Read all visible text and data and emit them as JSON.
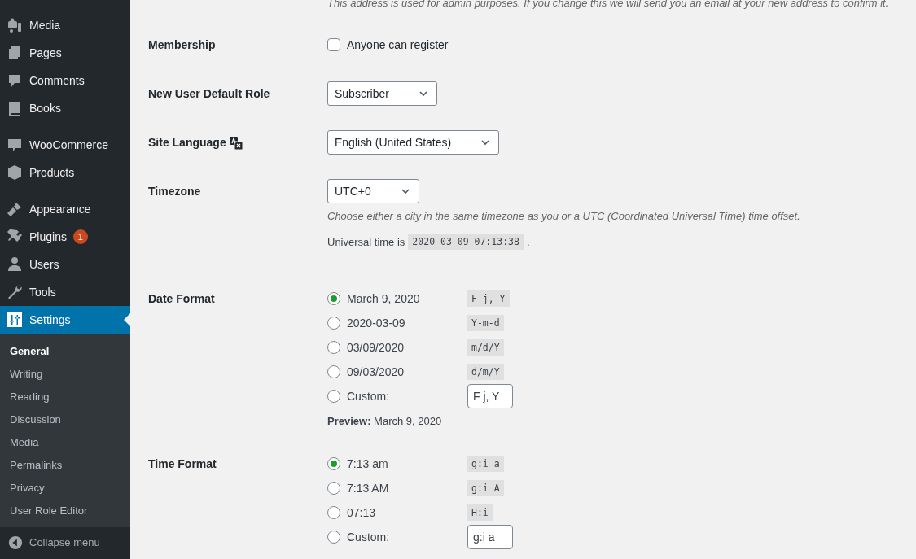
{
  "sidebar": {
    "groups": [
      [
        {
          "label": "Media",
          "selected": false
        },
        {
          "label": "Pages",
          "selected": false
        },
        {
          "label": "Comments",
          "selected": false
        },
        {
          "label": "Books",
          "selected": false
        }
      ],
      [
        {
          "label": "WooCommerce",
          "selected": false
        },
        {
          "label": "Products",
          "selected": false
        }
      ],
      [
        {
          "label": "Appearance",
          "selected": false
        },
        {
          "label": "Plugins",
          "selected": false,
          "badge": "1"
        },
        {
          "label": "Users",
          "selected": false
        },
        {
          "label": "Tools",
          "selected": false
        },
        {
          "label": "Settings",
          "selected": true
        }
      ]
    ],
    "submenu": [
      {
        "label": "General",
        "selected": true
      },
      {
        "label": "Writing",
        "selected": false
      },
      {
        "label": "Reading",
        "selected": false
      },
      {
        "label": "Discussion",
        "selected": false
      },
      {
        "label": "Media",
        "selected": false
      },
      {
        "label": "Permalinks",
        "selected": false
      },
      {
        "label": "Privacy",
        "selected": false
      },
      {
        "label": "User Role Editor",
        "selected": false
      }
    ],
    "collapse": "Collapse menu"
  },
  "top_description": "This address is used for admin purposes. If you change this we will send you an email at your new address to confirm it.",
  "settings": [
    {
      "kind": "checkbox",
      "label": "Membership",
      "option": {
        "label": "Anyone can register",
        "checked": false
      }
    },
    {
      "kind": "select",
      "label": "New User Default Role",
      "value": "Subscriber"
    },
    {
      "kind": "select",
      "label": "Site Language",
      "language_icon": true,
      "value": "English (United States)"
    },
    {
      "kind": "select",
      "label": "Timezone",
      "value": "UTC+0",
      "description": "Choose either a city in the same timezone as you or a UTC (Coordinated Universal Time) time offset.",
      "universal_time": {
        "prefix": "Universal time is",
        "value": "2020-03-09 07:13:38",
        "suffix": "."
      }
    },
    {
      "kind": "radios",
      "label": "Date Format",
      "options": [
        {
          "label": "March 9, 2020",
          "code": "F j, Y",
          "selected": true
        },
        {
          "label": "2020-03-09",
          "code": "Y-m-d",
          "selected": false
        },
        {
          "label": "03/09/2020",
          "code": "m/d/Y",
          "selected": false
        },
        {
          "label": "09/03/2020",
          "code": "d/m/Y",
          "selected": false
        }
      ],
      "custom": {
        "label": "Custom:",
        "value": "F j, Y",
        "selected": false
      },
      "preview": {
        "label": "Preview:",
        "value": "March 9, 2020"
      }
    },
    {
      "kind": "radios",
      "label": "Time Format",
      "options": [
        {
          "label": "7:13 am",
          "code": "g:i a",
          "selected": true
        },
        {
          "label": "7:13 AM",
          "code": "g:i A",
          "selected": false
        },
        {
          "label": "07:13",
          "code": "H:i",
          "selected": false
        }
      ],
      "custom": {
        "label": "Custom:",
        "value": "g:i a",
        "selected": false
      }
    }
  ]
}
